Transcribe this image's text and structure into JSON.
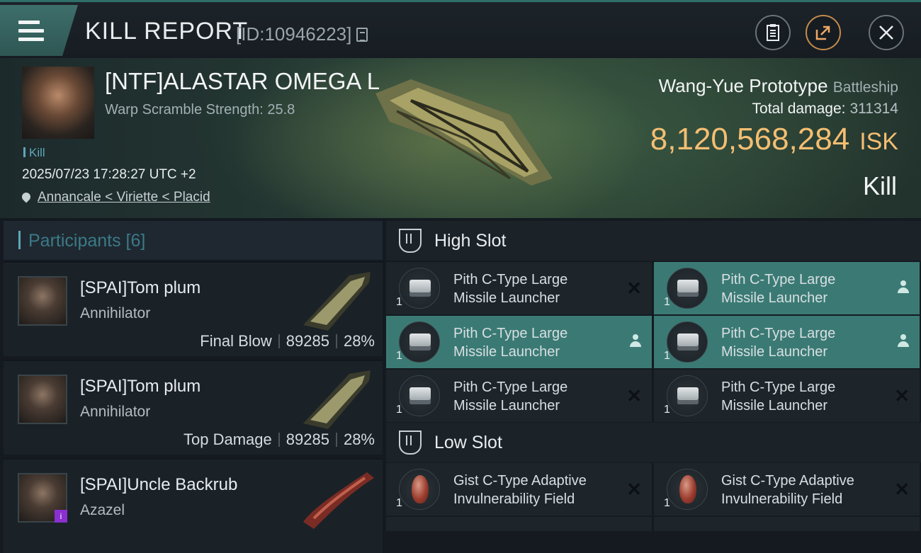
{
  "header": {
    "title": "KILL REPORT",
    "kill_id": "[ID:10946223]",
    "icons": [
      "menu-icon",
      "copy-icon",
      "clipboard-icon",
      "share-icon",
      "close-icon"
    ]
  },
  "victim": {
    "name": "[NTF]ALASTAR OMEGA L",
    "warp_scramble": "Warp Scramble Strength: 25.8",
    "tag": "Kill",
    "datetime": "2025/07/23 17:28:27 UTC +2",
    "location": "Annancale < Viriette < Placid",
    "ship_name": "Wang-Yue Prototype",
    "ship_class": "Battleship",
    "total_damage_label": "Total damage:",
    "total_damage": "311314",
    "isk_value": "8,120,568,284",
    "isk_unit": "ISK",
    "result": "Kill"
  },
  "participants": {
    "title": "Participants [6]",
    "rows": [
      {
        "name": "[SPAI]Tom plum",
        "ship": "Annihilator",
        "role": "Final Blow",
        "damage": "89285",
        "percent": "28%"
      },
      {
        "name": "[SPAI]Tom plum",
        "ship": "Annihilator",
        "role": "Top Damage",
        "damage": "89285",
        "percent": "28%"
      },
      {
        "name": "[SPAI]Uncle Backrub",
        "ship": "Azazel",
        "role": "",
        "damage": "",
        "percent": ""
      }
    ]
  },
  "fitting": {
    "high_slot_label": "High Slot",
    "low_slot_label": "Low Slot",
    "high": [
      {
        "line1": "Pith C-Type Large",
        "line2": "Missile Launcher",
        "qty": "1",
        "state": "destroyed"
      },
      {
        "line1": "Pith C-Type Large",
        "line2": "Missile Launcher",
        "qty": "1",
        "state": "dropped"
      },
      {
        "line1": "Pith C-Type Large",
        "line2": "Missile Launcher",
        "qty": "1",
        "state": "dropped"
      },
      {
        "line1": "Pith C-Type Large",
        "line2": "Missile Launcher",
        "qty": "1",
        "state": "dropped"
      },
      {
        "line1": "Pith C-Type Large",
        "line2": "Missile Launcher",
        "qty": "1",
        "state": "destroyed"
      },
      {
        "line1": "Pith C-Type Large",
        "line2": "Missile Launcher",
        "qty": "1",
        "state": "destroyed"
      }
    ],
    "low": [
      {
        "line1": "Gist C-Type Adaptive",
        "line2": "Invulnerability Field",
        "qty": "1",
        "state": "destroyed"
      },
      {
        "line1": "Gist C-Type Adaptive",
        "line2": "Invulnerability Field",
        "qty": "1",
        "state": "destroyed"
      }
    ],
    "state_marks": {
      "destroyed": "✕"
    }
  },
  "colors": {
    "accent": "#3b7a74",
    "isk": "#f4be72",
    "participants_label": "#3b7a88"
  }
}
